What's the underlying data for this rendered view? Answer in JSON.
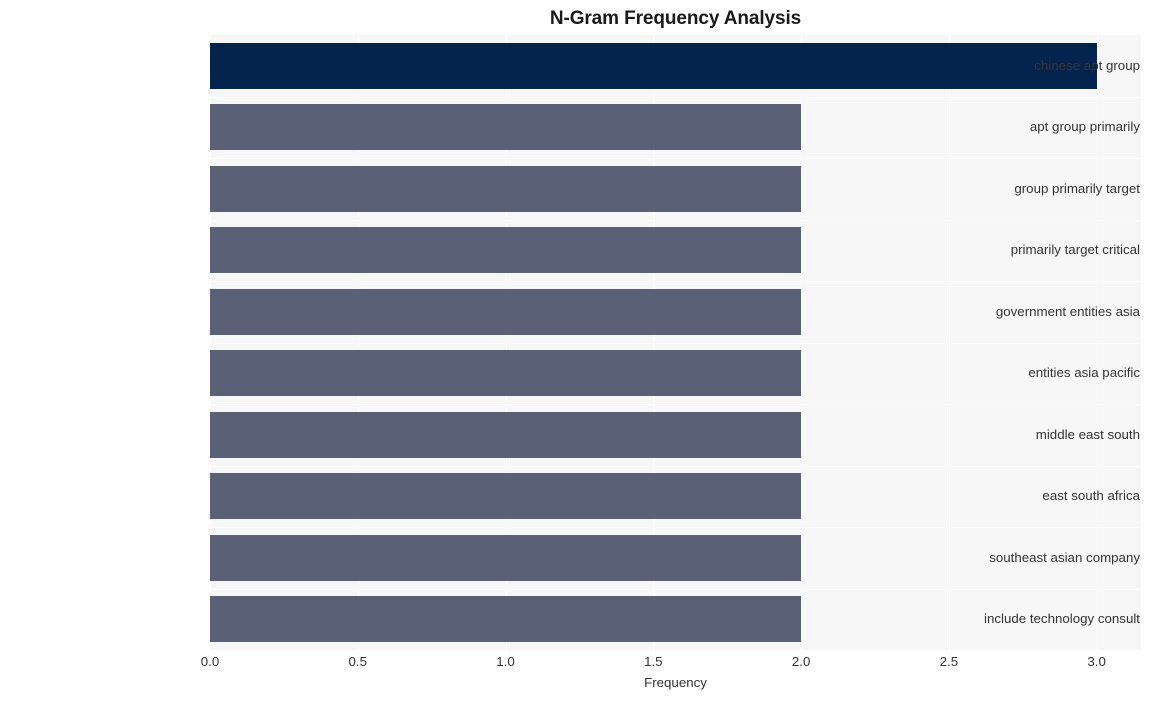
{
  "chart_data": {
    "type": "bar",
    "orientation": "horizontal",
    "title": "N-Gram Frequency Analysis",
    "xlabel": "Frequency",
    "ylabel": "",
    "categories": [
      "chinese apt group",
      "apt group primarily",
      "group primarily target",
      "primarily target critical",
      "government entities asia",
      "entities asia pacific",
      "middle east south",
      "east south africa",
      "southeast asian company",
      "include technology consult"
    ],
    "values": [
      3,
      2,
      2,
      2,
      2,
      2,
      2,
      2,
      2,
      2
    ],
    "xlim": [
      0,
      3.15
    ],
    "xticks": [
      "0.0",
      "0.5",
      "1.0",
      "1.5",
      "2.0",
      "2.5",
      "3.0"
    ],
    "xtick_values": [
      0,
      0.5,
      1,
      1.5,
      2,
      2.5,
      3
    ],
    "grid": true,
    "legend": false,
    "colors": {
      "highlight_bar": "#02244f",
      "default_bar": "#5a6075",
      "plot_background": "#f7f7f7",
      "gridline": "#ffffff",
      "figure_background": "#ffffff",
      "text": "#333333",
      "title_text": "#1a1a1a"
    },
    "highlight_index": 0
  }
}
